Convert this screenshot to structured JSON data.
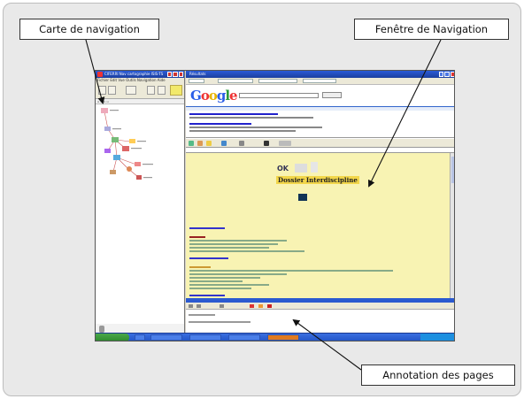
{
  "callouts": {
    "navigation_map": "Carte de navigation",
    "navigation_window": "Fenêtre de Navigation",
    "page_annotation": "Annotation des pages"
  },
  "left_app": {
    "title": "CIFERRI Nav cartographie ISIS-TS",
    "menu": "Fichier Edit Vue Outils Navigation Aide"
  },
  "right_app": {
    "title": "Résultats",
    "site_title": "Dossier Interdiscipline",
    "search_logo": "Google"
  },
  "colors": {
    "frame_bg": "#e9e9e9",
    "page_bg": "#f8f3b3",
    "taskbar": "#2456c8",
    "start_button": "#2d8a2d"
  },
  "icons": [
    "arrow-pointer-icon",
    "close-icon",
    "minimize-icon",
    "maximize-icon"
  ]
}
